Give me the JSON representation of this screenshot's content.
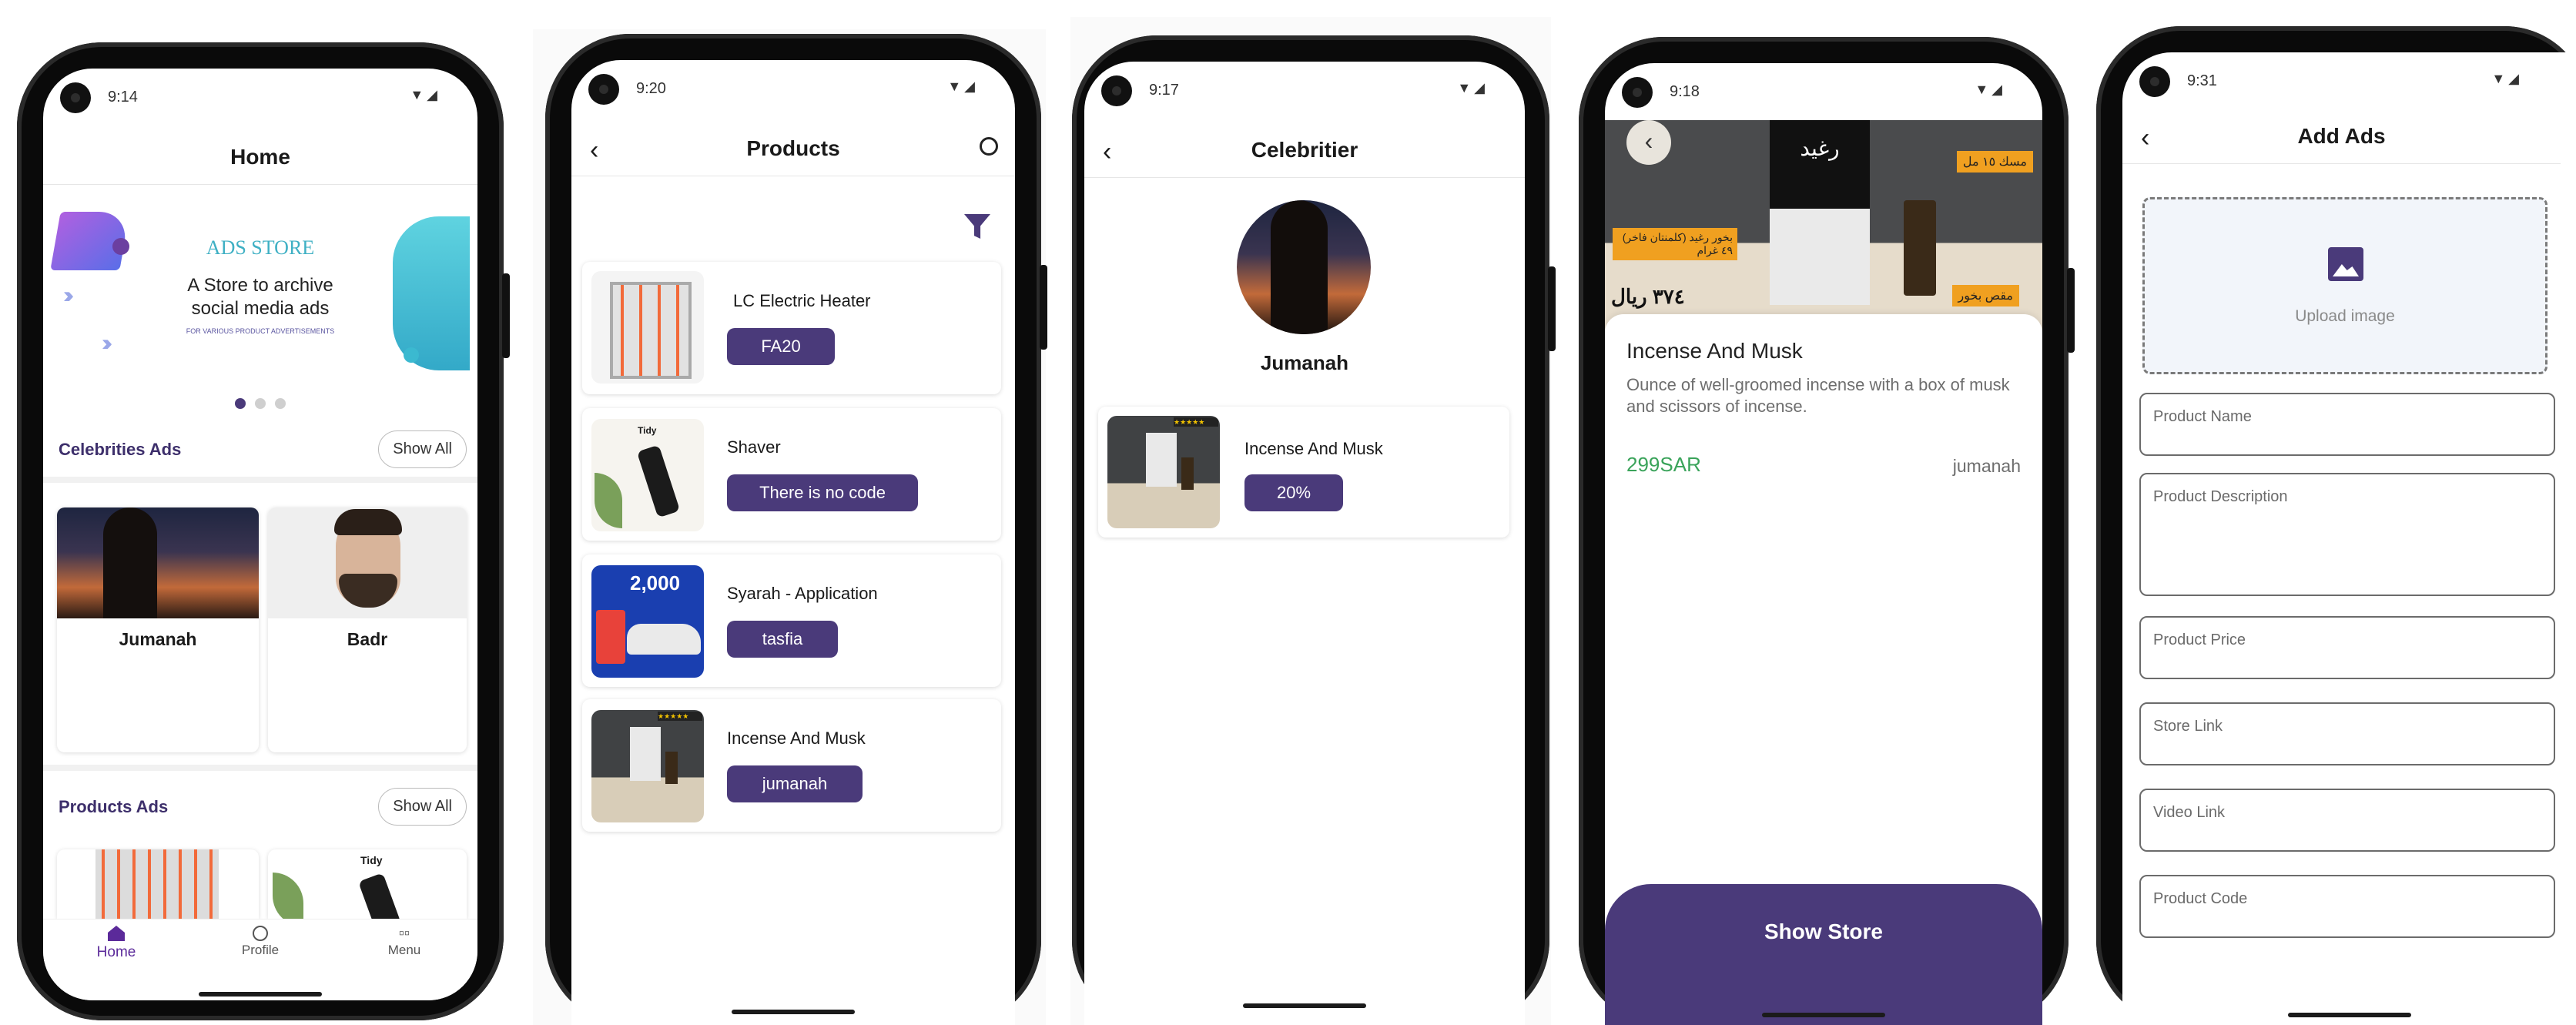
{
  "screens": {
    "home": {
      "time": "9:14",
      "title": "Home",
      "banner": {
        "brand": "ADS STORE",
        "line1": "A Store to archive",
        "line2": "social media ads",
        "small": "FOR VARIOUS PRODUCT ADVERTISEMENTS"
      },
      "celebrities_section": "Celebrities Ads",
      "show_all_1": "Show All",
      "celebrities": [
        {
          "name": "Jumanah"
        },
        {
          "name": "Badr"
        }
      ],
      "products_section": "Products Ads",
      "show_all_2": "Show All",
      "product_thumb_text": "Tidy",
      "nav": [
        {
          "label": "Home",
          "icon": "home-icon"
        },
        {
          "label": "Profile",
          "icon": "profile-icon"
        },
        {
          "label": "Menu",
          "icon": "menu-icon"
        }
      ]
    },
    "products": {
      "time": "9:20",
      "title": "Products",
      "items": [
        {
          "name": "LC Electric Heater",
          "code": "FA20"
        },
        {
          "name": "Shaver",
          "code": "There is no code",
          "thumb_text": "Tidy"
        },
        {
          "name": "Syarah - Application",
          "code": "tasfia",
          "thumb_text": "2,000"
        },
        {
          "name": "Incense And Musk",
          "code": "jumanah"
        }
      ]
    },
    "celebrity": {
      "time": "9:17",
      "title": "Celebritier",
      "name": "Jumanah",
      "item": {
        "name": "Incense And Musk",
        "discount": "20%"
      }
    },
    "detail": {
      "time": "9:18",
      "title": "Incense And Musk",
      "description": "Ounce of well-groomed incense with a box of musk and scissors of incense.",
      "price": "299SAR",
      "seller": "jumanah",
      "cta": "Show Store",
      "hero_texts": [
        "رغيد",
        "مسك ١٥ مل",
        "بخور رغيد (كلمنتان فاخر) ٤٩ غرام",
        "مقص بخور",
        "٣٧٤ ريال"
      ]
    },
    "addads": {
      "time": "9:31",
      "title": "Add Ads",
      "upload": "Upload image",
      "fields": [
        "Product Name",
        "Product Description",
        "Product Price",
        "Store Link",
        "Video Link",
        "Product Code"
      ]
    }
  },
  "colors": {
    "primary": "#4a3a7a",
    "price": "#3aa35a",
    "teal": "#4fc3d6",
    "purple": "#7c4dff"
  }
}
